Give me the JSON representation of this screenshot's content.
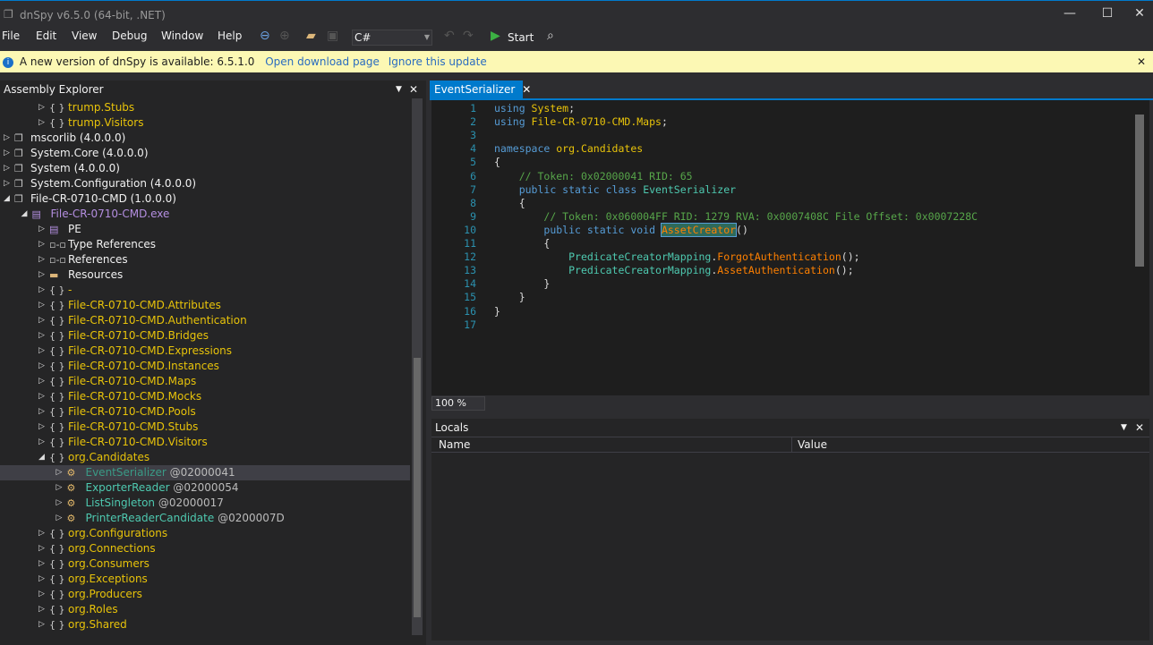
{
  "window": {
    "title": "dnSpy v6.5.0 (64-bit, .NET)"
  },
  "menu": [
    "File",
    "Edit",
    "View",
    "Debug",
    "Window",
    "Help"
  ],
  "toolbar": {
    "language": "C#",
    "start_label": "Start"
  },
  "notice": {
    "text": "A new version of dnSpy is available: 6.5.1.0",
    "download": "Open download page",
    "ignore": "Ignore this update"
  },
  "explorer": {
    "title": "Assembly Explorer",
    "rows": [
      {
        "label": "trump.Stubs",
        "kind": "ns",
        "depth": 2
      },
      {
        "label": "trump.Visitors",
        "kind": "ns",
        "depth": 2
      },
      {
        "label": "mscorlib (4.0.0.0)",
        "kind": "asm",
        "depth": 0
      },
      {
        "label": "System.Core (4.0.0.0)",
        "kind": "asm",
        "depth": 0
      },
      {
        "label": "System (4.0.0.0)",
        "kind": "asm",
        "depth": 0
      },
      {
        "label": "System.Configuration (4.0.0.0)",
        "kind": "asm",
        "depth": 0
      },
      {
        "label": "File-CR-0710-CMD (1.0.0.0)",
        "kind": "asm",
        "depth": 0,
        "open": true
      },
      {
        "label": "File-CR-0710-CMD.exe",
        "kind": "mod",
        "depth": 1,
        "open": true
      },
      {
        "label": "PE",
        "kind": "pe",
        "depth": 2
      },
      {
        "label": "Type References",
        "kind": "ref",
        "depth": 2
      },
      {
        "label": "References",
        "kind": "ref",
        "depth": 2
      },
      {
        "label": "Resources",
        "kind": "folder",
        "depth": 2
      },
      {
        "label": "-",
        "kind": "ns",
        "depth": 2
      },
      {
        "label": "File-CR-0710-CMD.Attributes",
        "kind": "ns",
        "depth": 2
      },
      {
        "label": "File-CR-0710-CMD.Authentication",
        "kind": "ns",
        "depth": 2
      },
      {
        "label": "File-CR-0710-CMD.Bridges",
        "kind": "ns",
        "depth": 2
      },
      {
        "label": "File-CR-0710-CMD.Expressions",
        "kind": "ns",
        "depth": 2
      },
      {
        "label": "File-CR-0710-CMD.Instances",
        "kind": "ns",
        "depth": 2
      },
      {
        "label": "File-CR-0710-CMD.Maps",
        "kind": "ns",
        "depth": 2
      },
      {
        "label": "File-CR-0710-CMD.Mocks",
        "kind": "ns",
        "depth": 2
      },
      {
        "label": "File-CR-0710-CMD.Pools",
        "kind": "ns",
        "depth": 2
      },
      {
        "label": "File-CR-0710-CMD.Stubs",
        "kind": "ns",
        "depth": 2
      },
      {
        "label": "File-CR-0710-CMD.Visitors",
        "kind": "ns",
        "depth": 2
      },
      {
        "label": "org.Candidates",
        "kind": "ns",
        "depth": 2,
        "open": true
      },
      {
        "label": "EventSerializer",
        "token": "@02000041",
        "kind": "type",
        "depth": 3,
        "selected": true
      },
      {
        "label": "ExporterReader",
        "token": "@02000054",
        "kind": "type",
        "depth": 3
      },
      {
        "label": "ListSingleton",
        "token": "@02000017",
        "kind": "type",
        "depth": 3
      },
      {
        "label": "PrinterReaderCandidate",
        "token": "@0200007D",
        "kind": "type",
        "depth": 3
      },
      {
        "label": "org.Configurations",
        "kind": "ns",
        "depth": 2
      },
      {
        "label": "org.Connections",
        "kind": "ns",
        "depth": 2
      },
      {
        "label": "org.Consumers",
        "kind": "ns",
        "depth": 2
      },
      {
        "label": "org.Exceptions",
        "kind": "ns",
        "depth": 2
      },
      {
        "label": "org.Producers",
        "kind": "ns",
        "depth": 2
      },
      {
        "label": "org.Roles",
        "kind": "ns",
        "depth": 2
      },
      {
        "label": "org.Shared",
        "kind": "ns",
        "depth": 2
      }
    ]
  },
  "editor": {
    "tab": "EventSerializer",
    "zoom": "100 %",
    "lines": [
      [
        [
          "kw",
          "using "
        ],
        [
          "ns2",
          "System"
        ],
        [
          "pl",
          ";"
        ]
      ],
      [
        [
          "kw",
          "using "
        ],
        [
          "ns2",
          "File-CR-0710-CMD.Maps"
        ],
        [
          "pl",
          ";"
        ]
      ],
      [],
      [
        [
          "kw",
          "namespace "
        ],
        [
          "ns2",
          "org.Candidates"
        ]
      ],
      [
        [
          "pl",
          "{"
        ]
      ],
      [
        [
          "pl",
          "    "
        ],
        [
          "cm",
          "// Token: 0x02000041 RID: 65"
        ]
      ],
      [
        [
          "pl",
          "    "
        ],
        [
          "kw",
          "public static class "
        ],
        [
          "ty",
          "EventSerializer"
        ]
      ],
      [
        [
          "pl",
          "    {"
        ]
      ],
      [
        [
          "pl",
          "        "
        ],
        [
          "cm",
          "// Token: 0x060004FF RID: 1279 RVA: 0x0007408C File Offset: 0x0007228C"
        ]
      ],
      [
        [
          "pl",
          "        "
        ],
        [
          "kw",
          "public static void "
        ],
        [
          "me hl",
          "AssetCreator"
        ],
        [
          "pl",
          "()"
        ]
      ],
      [
        [
          "pl",
          "        {"
        ]
      ],
      [
        [
          "pl",
          "            "
        ],
        [
          "ty",
          "PredicateCreatorMapping"
        ],
        [
          "pl",
          "."
        ],
        [
          "me",
          "ForgotAuthentication"
        ],
        [
          "pl",
          "();"
        ]
      ],
      [
        [
          "pl",
          "            "
        ],
        [
          "ty",
          "PredicateCreatorMapping"
        ],
        [
          "pl",
          "."
        ],
        [
          "me",
          "AssetAuthentication"
        ],
        [
          "pl",
          "();"
        ]
      ],
      [
        [
          "pl",
          "        }"
        ]
      ],
      [
        [
          "pl",
          "    }"
        ]
      ],
      [
        [
          "pl",
          "}"
        ]
      ],
      []
    ]
  },
  "locals": {
    "title": "Locals",
    "columns": [
      "Name",
      "Value"
    ]
  }
}
